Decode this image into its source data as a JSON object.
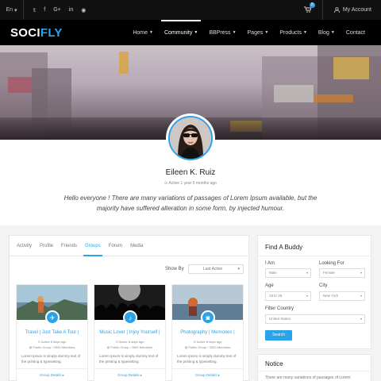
{
  "topbar": {
    "language": "En",
    "language_caret": "▾",
    "socials": [
      {
        "icon": "twitter-icon",
        "glyph": "𝕥"
      },
      {
        "icon": "facebook-icon",
        "glyph": "f"
      },
      {
        "icon": "google-plus-icon",
        "glyph": "G+"
      },
      {
        "icon": "linkedin-icon",
        "glyph": "in"
      },
      {
        "icon": "rss-icon",
        "glyph": "◉"
      }
    ],
    "cart_count": "0",
    "account_label": "My Account"
  },
  "nav": {
    "logo_part1": "SOCI",
    "logo_part2": "FLY",
    "items": [
      {
        "label": "Home",
        "has_caret": true,
        "active": false
      },
      {
        "label": "Community",
        "has_caret": true,
        "active": true
      },
      {
        "label": "BBPress",
        "has_caret": true,
        "active": false
      },
      {
        "label": "Pages",
        "has_caret": true,
        "active": false
      },
      {
        "label": "Products",
        "has_caret": true,
        "active": false
      },
      {
        "label": "Blog",
        "has_caret": true,
        "active": false
      },
      {
        "label": "Contact",
        "has_caret": false,
        "active": false
      }
    ]
  },
  "profile": {
    "name": "Eileen K. Ruiz",
    "active": "Active 1 year 5 months ago",
    "bio": "Hello everyone ! There are many variations of passages of Lorem Ipsum available, but the majority have suffered alteration in some form, by injected humour."
  },
  "tabs": [
    "Activity",
    "Profile",
    "Friends",
    "Groups",
    "Forum",
    "Media"
  ],
  "active_tab": 3,
  "showby": {
    "label": "Show By",
    "value": "Last Active"
  },
  "groups": [
    {
      "title": "Travel | Just Take A Tour |",
      "icon": "airplane-icon",
      "active": "Active 8 days ago",
      "meta": "Public Group / 2500 Members",
      "desc": "Lorem Ipsum is simply dummy text of the printing & typesetting.",
      "link": "Group Details"
    },
    {
      "title": "Music Lover | Injoy Yourself |",
      "icon": "music-note-icon",
      "active": "Active 8 days ago",
      "meta": "Public Group / 2500 Members",
      "desc": "Lorem Ipsum is simply dummy text of the printing & typesetting.",
      "link": "Group Details"
    },
    {
      "title": "Photography | Memories |",
      "icon": "camera-icon",
      "active": "Active 8 days ago",
      "meta": "Public Group / 2500 Members",
      "desc": "Lorem Ipsum is simply dummy text of the printing & typesetting.",
      "link": "Group Details"
    }
  ],
  "buddy": {
    "title": "Find A Buddy",
    "i_am_label": "I Am",
    "i_am_value": "Male",
    "looking_label": "Looking For",
    "looking_value": "Female",
    "age_label": "Age",
    "age_value": "18 to 25",
    "city_label": "City",
    "city_value": "New York",
    "country_label": "Filter Country",
    "country_value": "United States",
    "button": "Search"
  },
  "notice": {
    "title": "Notice",
    "text": "There are many variations of passages of Lorem"
  },
  "colors": {
    "accent": "#2aa3e8",
    "topbar": "#111111",
    "navbar": "#000000"
  }
}
